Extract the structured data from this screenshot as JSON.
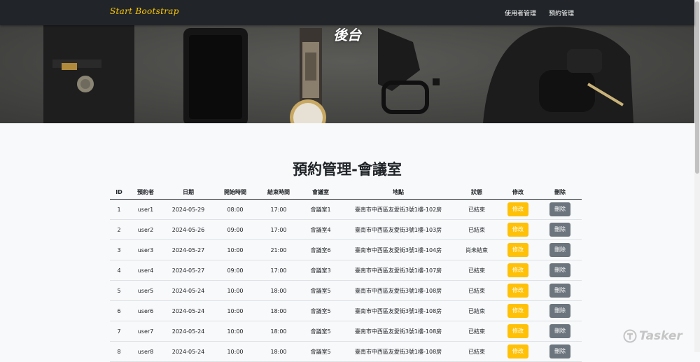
{
  "navbar": {
    "brand": "Start Bootstrap",
    "links": [
      {
        "label": "使用者管理"
      },
      {
        "label": "預約管理"
      }
    ]
  },
  "hero": {
    "title": "後台"
  },
  "section": {
    "title": "預約管理-會議室"
  },
  "table": {
    "headers": [
      "ID",
      "預約者",
      "日期",
      "開始時間",
      "結束時間",
      "會議室",
      "地點",
      "狀態",
      "修改",
      "刪除"
    ],
    "rows": [
      {
        "id": "1",
        "user": "user1",
        "date": "2024-05-29",
        "start": "08:00",
        "end": "17:00",
        "room": "會議室1",
        "location": "臺南市中西區友愛街3號1樓-102房",
        "status": "已結束",
        "edit": "修改",
        "delete": "刪除"
      },
      {
        "id": "2",
        "user": "user2",
        "date": "2024-05-26",
        "start": "09:00",
        "end": "17:00",
        "room": "會議室4",
        "location": "臺南市中西區友愛街3號1樓-103房",
        "status": "已結束",
        "edit": "修改",
        "delete": "刪除"
      },
      {
        "id": "3",
        "user": "user3",
        "date": "2024-05-27",
        "start": "10:00",
        "end": "21:00",
        "room": "會議室6",
        "location": "臺南市中西區友愛街3號1樓-104房",
        "status": "尚未結束",
        "edit": "修改",
        "delete": "刪除"
      },
      {
        "id": "4",
        "user": "user4",
        "date": "2024-05-27",
        "start": "09:00",
        "end": "17:00",
        "room": "會議室3",
        "location": "臺南市中西區友愛街3號1樓-107房",
        "status": "已結束",
        "edit": "修改",
        "delete": "刪除"
      },
      {
        "id": "5",
        "user": "user5",
        "date": "2024-05-24",
        "start": "10:00",
        "end": "18:00",
        "room": "會議室5",
        "location": "臺南市中西區友愛街3號1樓-108房",
        "status": "已結束",
        "edit": "修改",
        "delete": "刪除"
      },
      {
        "id": "6",
        "user": "user6",
        "date": "2024-05-24",
        "start": "10:00",
        "end": "18:00",
        "room": "會議室5",
        "location": "臺南市中西區友愛街3號1樓-108房",
        "status": "已結束",
        "edit": "修改",
        "delete": "刪除"
      },
      {
        "id": "7",
        "user": "user7",
        "date": "2024-05-24",
        "start": "10:00",
        "end": "18:00",
        "room": "會議室5",
        "location": "臺南市中西區友愛街3號1樓-108房",
        "status": "已結束",
        "edit": "修改",
        "delete": "刪除"
      },
      {
        "id": "8",
        "user": "user8",
        "date": "2024-05-24",
        "start": "10:00",
        "end": "18:00",
        "room": "會議室5",
        "location": "臺南市中西區友愛街3號1樓-108房",
        "status": "已結束",
        "edit": "修改",
        "delete": "刪除"
      }
    ]
  },
  "watermark": {
    "text": "Tasker"
  },
  "colors": {
    "navbar_bg": "#212529",
    "brand": "#ffc800",
    "edit_button": "#ffc107",
    "delete_button": "#6c757d"
  }
}
